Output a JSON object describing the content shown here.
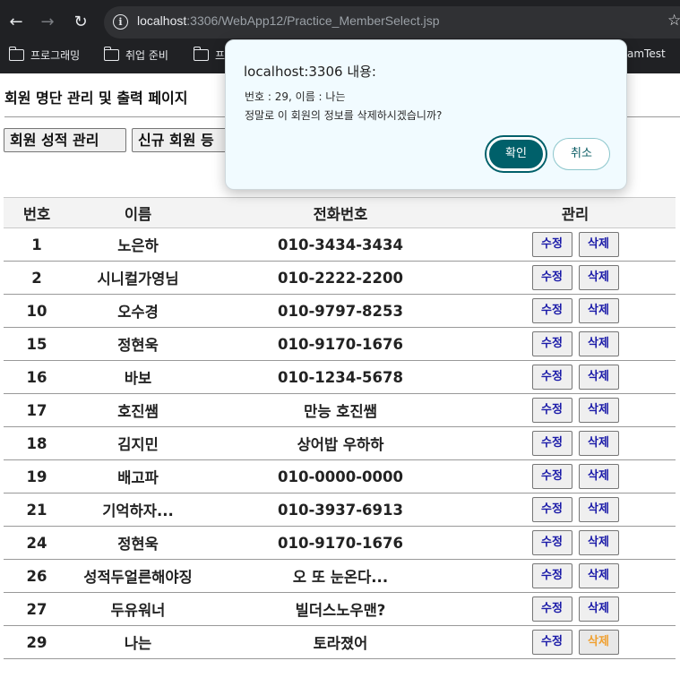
{
  "browser": {
    "url_host": "localhost",
    "url_path": ":3306/WebApp12/Practice_MemberSelect.jsp",
    "bookmarks": [
      "프로그래밍",
      "취업 준비",
      "프",
      "amTest"
    ]
  },
  "page": {
    "title": "회원 명단 관리 및 출력 페이지",
    "buttons": {
      "score": "회원 성적 관리",
      "new_member": "신규 회원 등"
    },
    "table": {
      "headers": [
        "번호",
        "이름",
        "전화번호",
        "관리"
      ],
      "edit_label": "수정",
      "delete_label": "삭제",
      "rows": [
        {
          "no": "1",
          "name": "노은하",
          "phone": "010-3434-3434"
        },
        {
          "no": "2",
          "name": "시니컬가영님",
          "phone": "010-2222-2200"
        },
        {
          "no": "10",
          "name": "오수경",
          "phone": "010-9797-8253"
        },
        {
          "no": "15",
          "name": "정현욱",
          "phone": "010-9170-1676"
        },
        {
          "no": "16",
          "name": "바보",
          "phone": "010-1234-5678"
        },
        {
          "no": "17",
          "name": "호진쌤",
          "phone": "만능 호진쌤"
        },
        {
          "no": "18",
          "name": "김지민",
          "phone": "상어밥 우하하"
        },
        {
          "no": "19",
          "name": "배고파",
          "phone": "010-0000-0000"
        },
        {
          "no": "21",
          "name": "기억하자...",
          "phone": "010-3937-6913"
        },
        {
          "no": "24",
          "name": "정현욱",
          "phone": "010-9170-1676"
        },
        {
          "no": "26",
          "name": "성적두얼른해야징",
          "phone": "오 또 눈온다..."
        },
        {
          "no": "27",
          "name": "두유워너",
          "phone": "빌더스노우맨?"
        },
        {
          "no": "29",
          "name": "나는",
          "phone": "토라졌어"
        }
      ]
    }
  },
  "dialog": {
    "title": "localhost:3306 내용:",
    "line1": "번호 : 29, 이름 : 나는",
    "line2": "정말로 이 회원의 정보를 삭제하시겠습니까?",
    "ok_label": "확인",
    "cancel_label": "취소"
  },
  "icons": {
    "back": "back-arrow-icon",
    "forward": "forward-arrow-icon",
    "reload": "reload-icon",
    "info": "info-icon",
    "star": "star-icon",
    "folder": "folder-icon"
  }
}
